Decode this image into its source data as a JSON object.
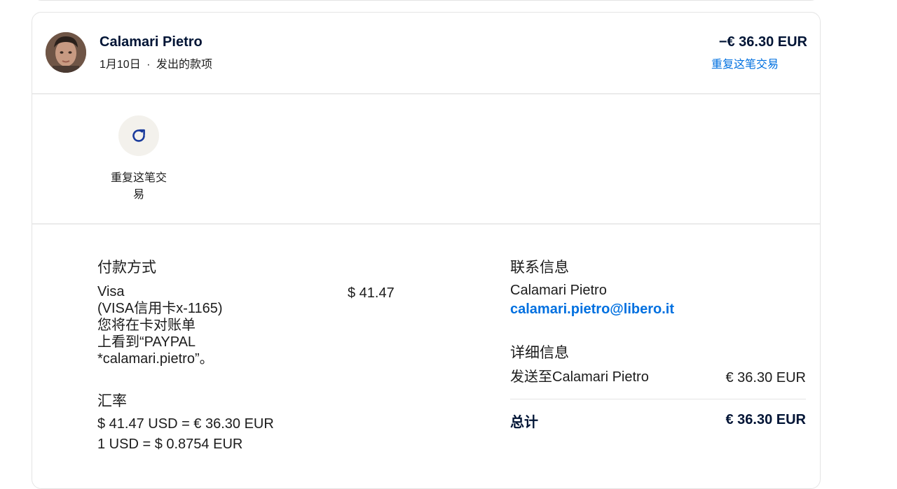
{
  "transaction": {
    "name": "Calamari Pietro",
    "date": "1月10日",
    "separator": "·",
    "type": "发出的款项",
    "amount": "−€ 36.30 EUR",
    "repeat_link": "重复这笔交易"
  },
  "actions": {
    "repeat_label": "重复这笔交易"
  },
  "payment_method": {
    "title": "付款方式",
    "description": "Visa\n(VISA信用卡x-1165)\n您将在卡对账单\n上看到“PAYPAL\n*calamari.pietro”。",
    "amount": "$ 41.47"
  },
  "exchange_rate": {
    "title": "汇率",
    "conversion": "$ 41.47 USD = € 36.30 EUR",
    "rate": "1 USD = $ 0.8754 EUR"
  },
  "contact": {
    "title": "联系信息",
    "name": "Calamari Pietro",
    "email": "calamari.pietro@libero.it"
  },
  "details": {
    "title": "详细信息",
    "sent_to_label": "发送至Calamari Pietro",
    "sent_to_amount": "€ 36.30 EUR",
    "total_label": "总计",
    "total_amount": "€ 36.30 EUR"
  },
  "colors": {
    "link": "#0070e0",
    "heading": "#001435",
    "icon": "#1a3b9c"
  }
}
